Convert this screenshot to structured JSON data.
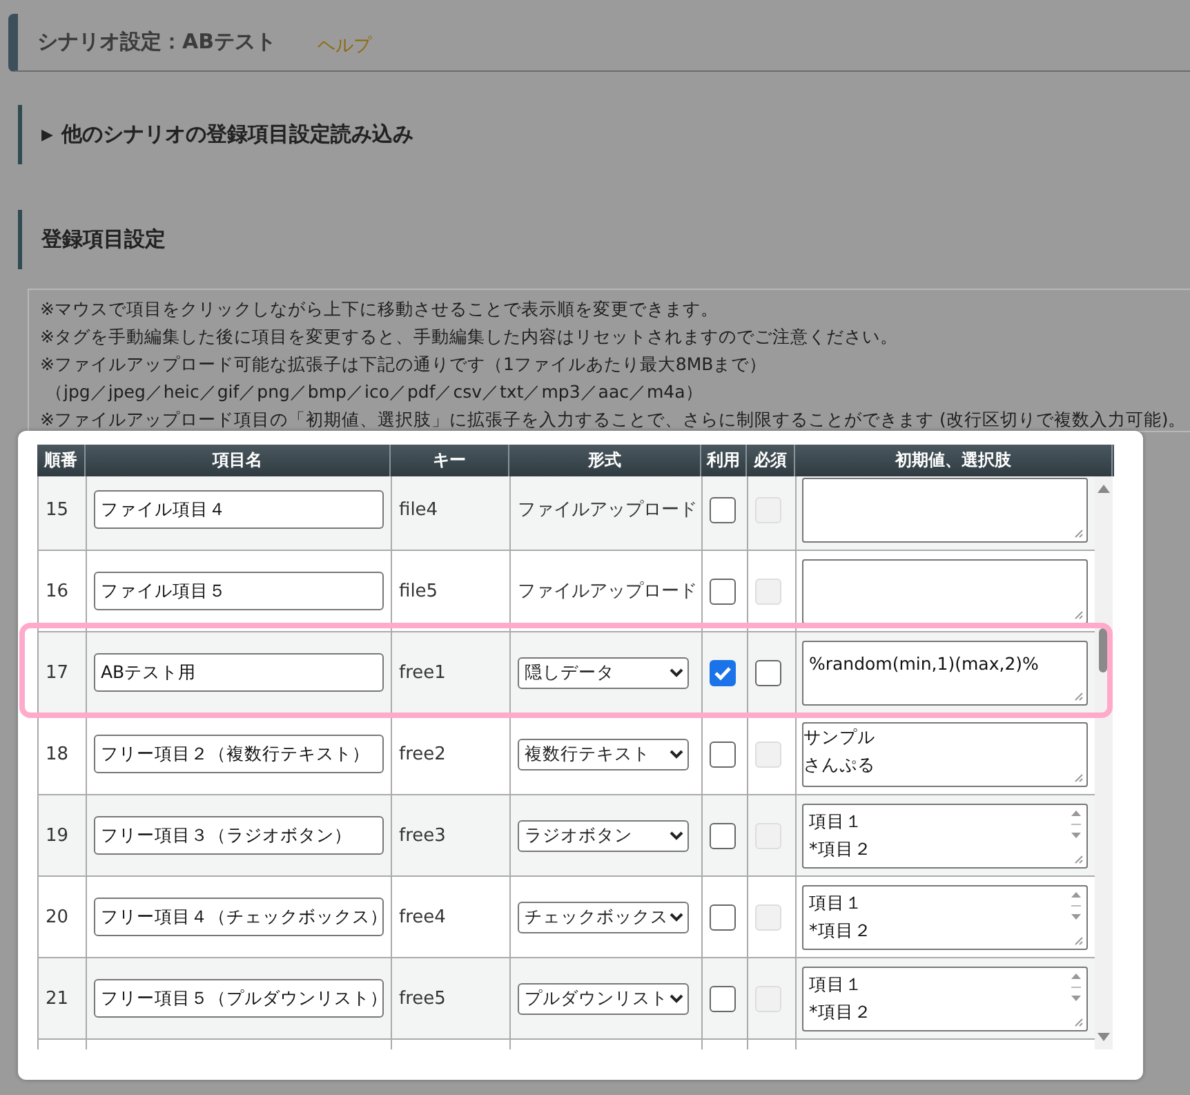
{
  "header": {
    "title": "シナリオ設定：ABテスト",
    "help_link": "ヘルプ"
  },
  "sections": [
    {
      "marker": "▶",
      "title": "他のシナリオの登録項目設定読み込み"
    },
    {
      "title": "登録項目設定"
    }
  ],
  "notes": [
    "※マウスで項目をクリックしながら上下に移動させることで表示順を変更できます。",
    "※タグを手動編集した後に項目を変更すると、手動編集した内容はリセットされますのでご注意ください。",
    "※ファイルアップロード可能な拡張子は下記の通りです（1ファイルあたり最大8MBまで）",
    "（jpg／jpeg／heic／gif／png／bmp／ico／pdf／csv／txt／mp3／aac／m4a）",
    "※ファイルアップロード項目の「初期値、選択肢」に拡張子を入力することで、さらに制限することができます (改行区切りで複数入力可能)。"
  ],
  "table": {
    "columns": [
      "順番",
      "項目名",
      "キー",
      "形式",
      "利用",
      "必須",
      "初期値、選択肢"
    ],
    "rows": [
      {
        "number": "15",
        "name": "ファイル項目４",
        "key": "file4",
        "format": {
          "kind": "text",
          "value": "ファイルアップロード"
        },
        "use_checked": false,
        "required": {
          "checked": false,
          "disabled": true
        },
        "initial": {
          "kind": "plain"
        },
        "highlighted": false
      },
      {
        "number": "16",
        "name": "ファイル項目５",
        "key": "file5",
        "format": {
          "kind": "text",
          "value": "ファイルアップロード"
        },
        "use_checked": false,
        "required": {
          "checked": false,
          "disabled": true
        },
        "initial": {
          "kind": "plain"
        },
        "highlighted": false
      },
      {
        "number": "17",
        "name": "ABテスト用",
        "key": "free1",
        "format": {
          "kind": "select",
          "value": "隠しデータ"
        },
        "use_checked": true,
        "required": {
          "checked": false,
          "disabled": false
        },
        "initial": {
          "kind": "plain",
          "lines": [
            "%random(min,1)(max,2)%"
          ]
        },
        "highlighted": true
      },
      {
        "number": "18",
        "name": "フリー項目２（複数行テキスト）",
        "key": "free2",
        "format": {
          "kind": "select",
          "value": "複数行テキスト"
        },
        "use_checked": false,
        "required": {
          "checked": false,
          "disabled": true
        },
        "initial": {
          "kind": "scrolled",
          "lines": [
            "サンプル",
            "さんぷる"
          ]
        },
        "highlighted": false
      },
      {
        "number": "19",
        "name": "フリー項目３（ラジオボタン）",
        "key": "free3",
        "format": {
          "kind": "select",
          "value": "ラジオボタン"
        },
        "use_checked": false,
        "required": {
          "checked": false,
          "disabled": true
        },
        "initial": {
          "kind": "list",
          "lines": [
            "項目１",
            "*項目２"
          ]
        },
        "highlighted": false
      },
      {
        "number": "20",
        "name": "フリー項目４（チェックボックス）",
        "key": "free4",
        "format": {
          "kind": "select",
          "value": "チェックボックス"
        },
        "use_checked": false,
        "required": {
          "checked": false,
          "disabled": true
        },
        "initial": {
          "kind": "list",
          "lines": [
            "項目１",
            "*項目２"
          ]
        },
        "highlighted": false
      },
      {
        "number": "21",
        "name": "フリー項目５（プルダウンリスト）",
        "key": "free5",
        "format": {
          "kind": "select",
          "value": "プルダウンリスト"
        },
        "use_checked": false,
        "required": {
          "checked": false,
          "disabled": true
        },
        "initial": {
          "kind": "list",
          "lines": [
            "項目１",
            "*項目２"
          ]
        },
        "highlighted": false
      }
    ]
  }
}
